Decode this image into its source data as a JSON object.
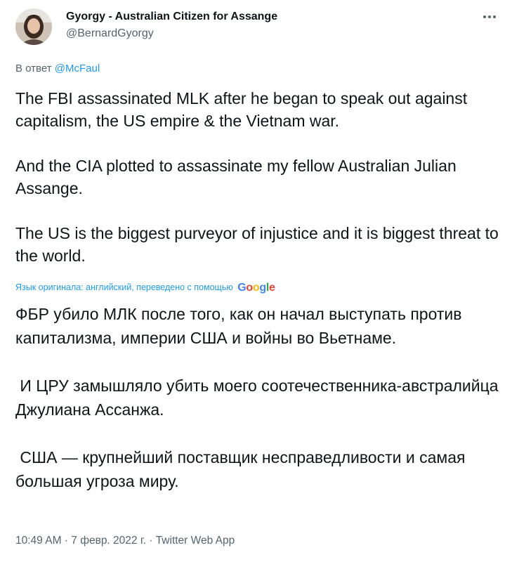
{
  "author": {
    "display_name": "Gyorgy - Australian Citizen for Assange",
    "handle": "@BernardGyorgy",
    "avatar_icon": "user-avatar"
  },
  "reply": {
    "prefix": "В ответ",
    "mention": "@McFaul"
  },
  "tweet_text": {
    "paragraphs": [
      "The FBI assassinated MLK after he began to speak out against capitalism, the US empire & the Vietnam war.",
      "And the CIA plotted to assassinate my fellow Australian Julian Assange.",
      "The US is the biggest purveyor of injustice and it is biggest threat to the world."
    ]
  },
  "translation": {
    "note": "Язык оригинала: английский, переведено с помощью",
    "provider_logo": "Google",
    "paragraphs": [
      "ФБР убило МЛК после того, как он начал выступать против капитализма, империи США и войны во Вьетнаме.",
      " И ЦРУ замышляло убить моего соотечественника-австралийца Джулиана Ассанжа.",
      " США — крупнейший поставщик несправедливости и самая большая угроза миру."
    ]
  },
  "meta": {
    "time": "10:49 AM",
    "separator": " · ",
    "date": "7 февр. 2022 г.",
    "source": "Twitter Web App"
  },
  "colors": {
    "link": "#1d9bf0",
    "secondary_text": "#536471",
    "primary_text": "#0f1419"
  },
  "icons": {
    "more": "more-horizontal-icon"
  }
}
